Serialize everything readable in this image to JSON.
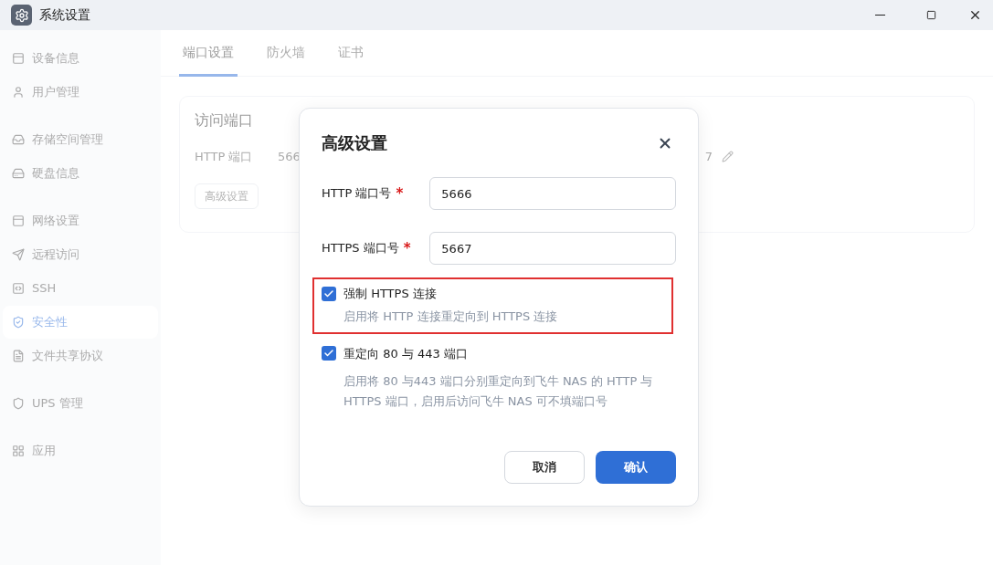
{
  "window": {
    "title": "系统设置"
  },
  "sidebar": {
    "groups": [
      {
        "items": [
          {
            "label": "设备信息",
            "selected": false
          },
          {
            "label": "用户管理",
            "selected": false
          }
        ]
      },
      {
        "items": [
          {
            "label": "存储空间管理",
            "selected": false
          },
          {
            "label": "硬盘信息",
            "selected": false
          }
        ]
      },
      {
        "items": [
          {
            "label": "网络设置",
            "selected": false
          },
          {
            "label": "远程访问",
            "selected": false
          },
          {
            "label": "SSH",
            "selected": false
          },
          {
            "label": "安全性",
            "selected": true
          },
          {
            "label": "文件共享协议",
            "selected": false
          }
        ]
      },
      {
        "items": [
          {
            "label": "UPS 管理",
            "selected": false
          }
        ]
      },
      {
        "items": [
          {
            "label": "应用",
            "selected": false
          }
        ]
      }
    ]
  },
  "tabs": [
    {
      "label": "端口设置",
      "selected": true
    },
    {
      "label": "防火墙",
      "selected": false
    },
    {
      "label": "证书",
      "selected": false
    }
  ],
  "card": {
    "title": "访问端口",
    "http_label": "HTTP 端口",
    "http_value": "566",
    "https_value": "7",
    "button": "高级设置"
  },
  "dialog": {
    "title": "高级设置",
    "fields": [
      {
        "label": "HTTP 端口号",
        "required_mark": "*",
        "value": "5666"
      },
      {
        "label": "HTTPS 端口号",
        "required_mark": "*",
        "value": "5667"
      }
    ],
    "options": [
      {
        "label": "强制 HTTPS 连接",
        "checked": true,
        "highlighted": true,
        "description": "启用将 HTTP 连接重定向到 HTTPS 连接"
      },
      {
        "label": "重定向 80 与 443 端口",
        "checked": true,
        "highlighted": false,
        "description": "启用将 80 与443 端口分别重定向到飞牛 NAS 的 HTTP 与 HTTPS 端口，启用后访问飞牛 NAS 可不填端口号"
      }
    ],
    "buttons": {
      "cancel": "取消",
      "confirm": "确认"
    }
  }
}
